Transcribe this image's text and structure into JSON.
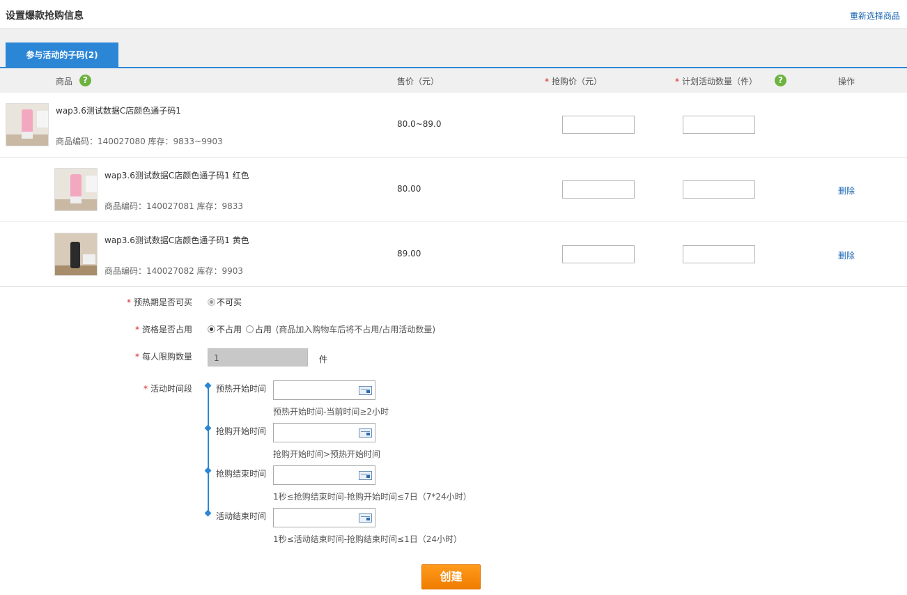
{
  "header": {
    "title": "设置爆款抢购信息",
    "reselect_label": "重新选择商品"
  },
  "tabs": [
    {
      "label": "参与活动的子码(2)",
      "active": true
    }
  ],
  "table": {
    "columns": {
      "product": "商品",
      "price": "售价（元）",
      "rush_price": "抢购价（元）",
      "quantity": "计划活动数量（件）",
      "action": "操作"
    },
    "help_glyph": "?",
    "required_mark": "*",
    "rows": [
      {
        "name": "wap3.6测试数据C店颜色通子码1",
        "meta": "商品编码：140027080 库存：9833~9903",
        "price": "80.0~89.0",
        "action": ""
      },
      {
        "name": "wap3.6测试数据C店颜色通子码1 红色",
        "meta": "商品编码：140027081 库存：9833",
        "price": "80.00",
        "action": "删除"
      },
      {
        "name": "wap3.6测试数据C店颜色通子码1 黄色",
        "meta": "商品编码：140027082 库存：9903",
        "price": "89.00",
        "action": "删除"
      }
    ]
  },
  "form": {
    "preheat_buy": {
      "label": "预热期是否可买",
      "option": "不可买"
    },
    "occupy": {
      "label": "资格是否占用",
      "option1": "不占用",
      "option2": "占用",
      "note": "(商品加入购物车后将不占用/占用活动数量)"
    },
    "limit": {
      "label": "每人限购数量",
      "value": "1",
      "unit": "件"
    },
    "period": {
      "label": "活动时间段",
      "steps": [
        {
          "label": "预热开始时间",
          "hint": "预热开始时间-当前时间≥2小时"
        },
        {
          "label": "抢购开始时间",
          "hint": "抢购开始时间>预热开始时间"
        },
        {
          "label": "抢购结束时间",
          "hint": "1秒≤抢购结束时间-抢购开始时间≤7日（7*24小时）"
        },
        {
          "label": "活动结束时间",
          "hint": "1秒≤活动结束时间-抢购结束时间≤1日（24小时）"
        }
      ]
    }
  },
  "submit_label": "创建",
  "colors": {
    "accent": "#2b86d6",
    "link": "#1a66b3",
    "button": "#f08a00",
    "help": "#6cb33f",
    "required": "#dd2222"
  }
}
